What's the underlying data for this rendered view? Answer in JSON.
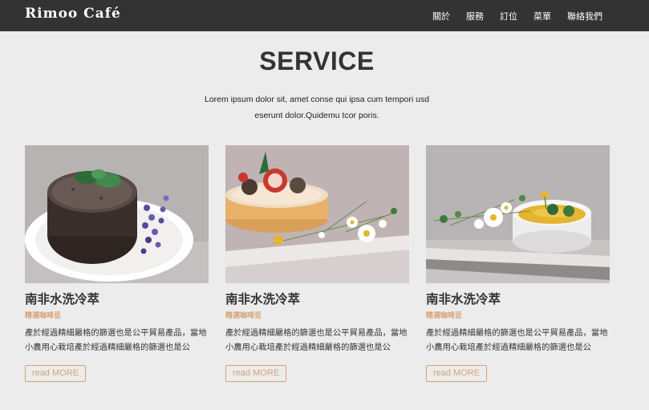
{
  "navbar": {
    "brand": "Rimoo Café",
    "links": [
      "關於",
      "服務",
      "訂位",
      "菜單",
      "聯絡我們"
    ]
  },
  "section": {
    "title": "SERVICE",
    "intro_line1": "Lorem ipsum dolor sit, amet conse qui ipsa cum tempori usd",
    "intro_line2": "eserunt dolor.Quidemu tcor poris."
  },
  "cards": [
    {
      "image": "chocolate-lava-cake-photo",
      "title": "南非水洗冷萃",
      "subtitle": "精選咖啡豆",
      "description": "產於經過精細嚴格的篩選也是公平貿易產品，當地小農用心栽培產於經過精細嚴格的篩選也是公",
      "button": "read MORE"
    },
    {
      "image": "strawberry-tart-photo",
      "title": "南非水洗冷萃",
      "subtitle": "精選咖啡豆",
      "description": "產於經過精細嚴格的篩選也是公平貿易產品，當地小農用心栽培產於經過精細嚴格的篩選也是公",
      "button": "read MORE"
    },
    {
      "image": "creme-brulee-photo",
      "title": "南非水洗冷萃",
      "subtitle": "精選咖啡豆",
      "description": "產於經過精細嚴格的篩選也是公平貿易產品，當地小農用心栽培產於經過精細嚴格的篩選也是公",
      "button": "read MORE"
    }
  ],
  "colors": {
    "navbar_bg": "#333333",
    "page_bg": "#ececec",
    "accent": "#d4a373"
  }
}
